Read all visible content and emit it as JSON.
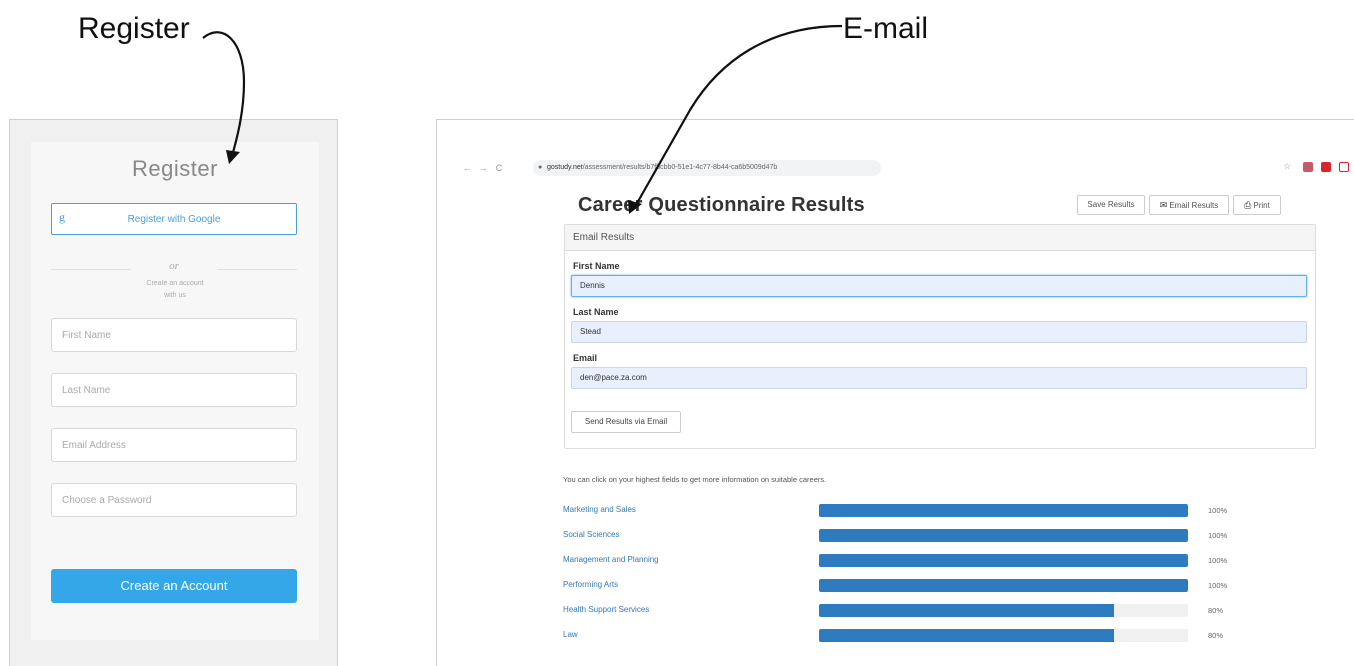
{
  "annotations": {
    "register": "Register",
    "email": "E-mail"
  },
  "register_form": {
    "title": "Register",
    "google_button": "Register with Google",
    "google_icon": "g-icon",
    "or": "or",
    "create_line1": "Create an account",
    "create_line2": "with us",
    "first_name_placeholder": "First Name",
    "last_name_placeholder": "Last Name",
    "email_placeholder": "Email Address",
    "password_placeholder": "Choose a Password",
    "submit": "Create an Account",
    "accent": "#33a7e8"
  },
  "browser": {
    "back": "←",
    "forward": "→",
    "reload": "C",
    "url_host": "gostudy.net",
    "url_path": "/assessment/results/b7fbcbb0-51e1-4c77-8b44-ca6b5009d47b",
    "star": "☆"
  },
  "results": {
    "title": "Career Questionnaire Results",
    "save_button": "Save Results",
    "email_button": "Email Results",
    "print_button": "Print",
    "email_panel": {
      "heading": "Email Results",
      "first_name_label": "First Name",
      "first_name_value": "Dennis",
      "last_name_label": "Last Name",
      "last_name_value": "Stead",
      "email_label": "Email",
      "email_value": "den@pace.za.com",
      "send_button": "Send Results via Email"
    },
    "hint": "You can click on your highest fields to get more information on suitable careers.",
    "fields": [
      {
        "label": "Marketing and Sales",
        "value": 100,
        "pct": "100%"
      },
      {
        "label": "Social Sciences",
        "value": 100,
        "pct": "100%"
      },
      {
        "label": "Management and Planning",
        "value": 100,
        "pct": "100%"
      },
      {
        "label": "Performing Arts",
        "value": 100,
        "pct": "100%"
      },
      {
        "label": "Health Support Services",
        "value": 80,
        "pct": "80%"
      },
      {
        "label": "Law",
        "value": 80,
        "pct": "80%"
      }
    ],
    "bar_color": "#2f7bbf"
  }
}
